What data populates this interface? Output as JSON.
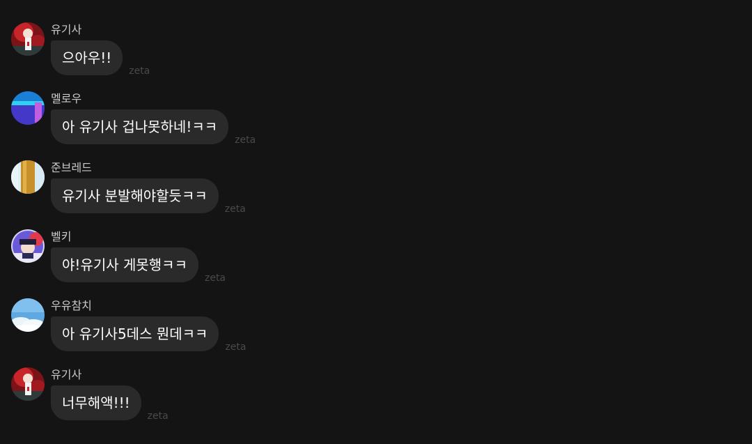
{
  "messages": [
    {
      "sender": "유기사",
      "text": "으아우!!",
      "source": "zeta",
      "avatar": "red-character-avatar"
    },
    {
      "sender": "멜로우",
      "text": "아 유기사 겁나못하네!ㅋㅋ",
      "source": "zeta",
      "avatar": "blue-purple-avatar"
    },
    {
      "sender": "준브레드",
      "text": "유기사 분발해야할듯ㅋㅋ",
      "source": "zeta",
      "avatar": "gold-stripe-avatar"
    },
    {
      "sender": "벨키",
      "text": "야!유기사 게못행ㅋㅋ",
      "source": "zeta",
      "avatar": "hat-character-avatar"
    },
    {
      "sender": "우유참치",
      "text": "아 유기사5데스 뭔데ㅋㅋ",
      "source": "zeta",
      "avatar": "sky-clouds-avatar"
    },
    {
      "sender": "유기사",
      "text": "너무해액!!!",
      "source": "zeta",
      "avatar": "red-character-avatar"
    }
  ],
  "colors": {
    "background": "#141414",
    "bubble": "#2a2a2a",
    "text": "#ffffff",
    "sender": "#c9c9c9",
    "source": "#4a4a4a"
  }
}
